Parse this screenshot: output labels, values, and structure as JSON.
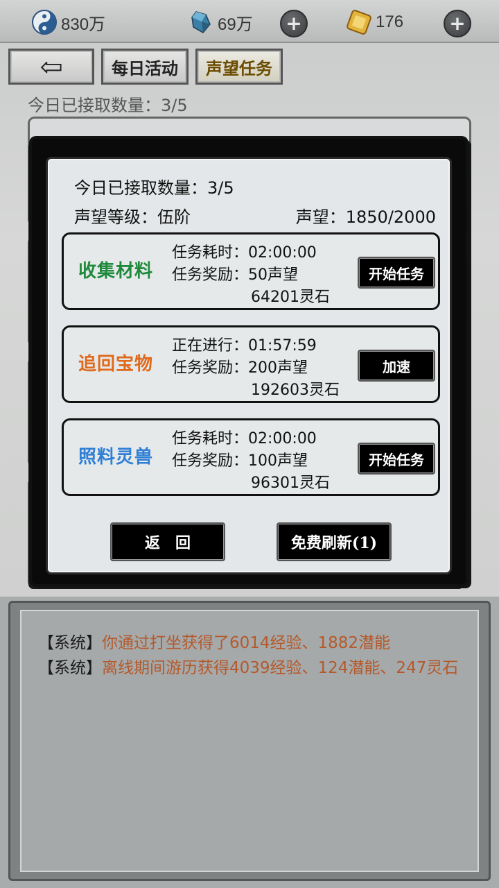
{
  "resources": {
    "taiji": {
      "value": "830万",
      "icon": "taiji-icon"
    },
    "crystal": {
      "value": "69万",
      "icon": "crystal-icon"
    },
    "gold": {
      "value": "176",
      "icon": "gold-ingot-icon"
    }
  },
  "nav": {
    "back_label": "⇦",
    "daily_label": "每日活动",
    "reputation_label": "声望任务"
  },
  "accepted_count": "今日已接取数量：3/5",
  "dialog": {
    "accepted": "今日已接取数量：3/5",
    "level": "声望等级：伍阶",
    "reputation": "声望：1850/2000",
    "tasks": [
      {
        "name": "收集材料",
        "name_color": "#1f8a3c",
        "line1": "任务耗时：02:00:00",
        "line2": "任务奖励：50声望",
        "line3": "64201灵石",
        "button": "开始任务"
      },
      {
        "name": "追回宝物",
        "name_color": "#e0691c",
        "line1": "正在进行：01:57:59",
        "line2": "任务奖励：200声望",
        "line3": "192603灵石",
        "button": "加速"
      },
      {
        "name": "照料灵兽",
        "name_color": "#2f7fd6",
        "line1": "任务耗时：02:00:00",
        "line2": "任务奖励：100声望",
        "line3": "96301灵石",
        "button": "开始任务"
      }
    ],
    "back_button": "返　回",
    "refresh_button": "免费刷新(1)"
  },
  "log": {
    "lines": [
      {
        "tag": "【系统】",
        "msg": "你通过打坐获得了6014经验、1882潜能"
      },
      {
        "tag": "【系统】",
        "msg": "离线期间游历获得4039经验、124潜能、247灵石"
      }
    ]
  }
}
